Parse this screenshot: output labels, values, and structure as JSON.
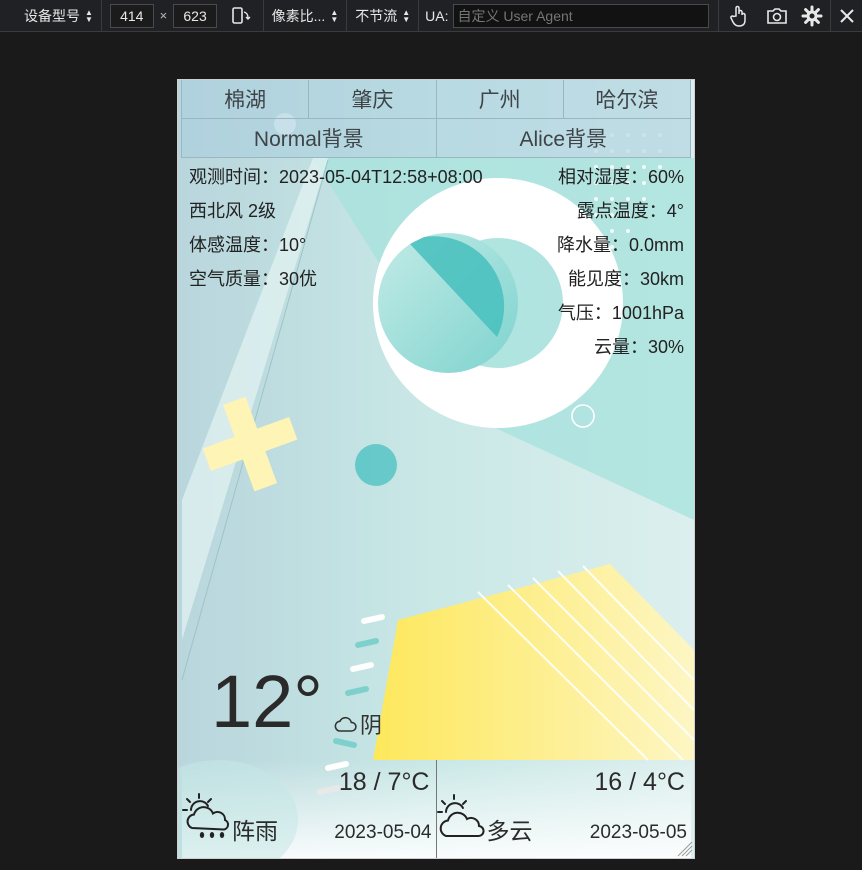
{
  "toolbar": {
    "device_model": "设备型号",
    "width": "414",
    "times": "×",
    "height": "623",
    "pixel_ratio": "像素比...",
    "throttle": "不节流",
    "ua_label": "UA:",
    "ua_placeholder": "自定义 User Agent"
  },
  "tabs": {
    "cities": [
      "棉湖",
      "肇庆",
      "广州",
      "哈尔滨"
    ],
    "backgrounds": [
      "Normal背景",
      "Alice背景"
    ]
  },
  "observation": {
    "time": "观测时间：2023-05-04T12:58+08:00",
    "wind": "西北风 2级",
    "feels_like": "体感温度：10°",
    "air_quality": "空气质量：30优",
    "humidity": "相对湿度：60%",
    "dew_point": "露点温度：4°",
    "precipitation": "降水量：0.0mm",
    "visibility": "能见度：30km",
    "pressure": "气压：1001hPa",
    "cloud": "云量：30%"
  },
  "current": {
    "temperature": "12°",
    "condition": "阴",
    "condition_icon": "cloud-icon"
  },
  "forecast": [
    {
      "temp_range": "18 / 7°C",
      "condition": "阵雨",
      "date": "2023-05-04",
      "icon": "sun-cloud-rain-icon"
    },
    {
      "temp_range": "16 / 4°C",
      "condition": "多云",
      "date": "2023-05-05",
      "icon": "sun-cloud-icon"
    }
  ],
  "colors": {
    "teal": "#3bbfbf",
    "yellow": "#fde96a",
    "background": "#1a1a1b"
  }
}
